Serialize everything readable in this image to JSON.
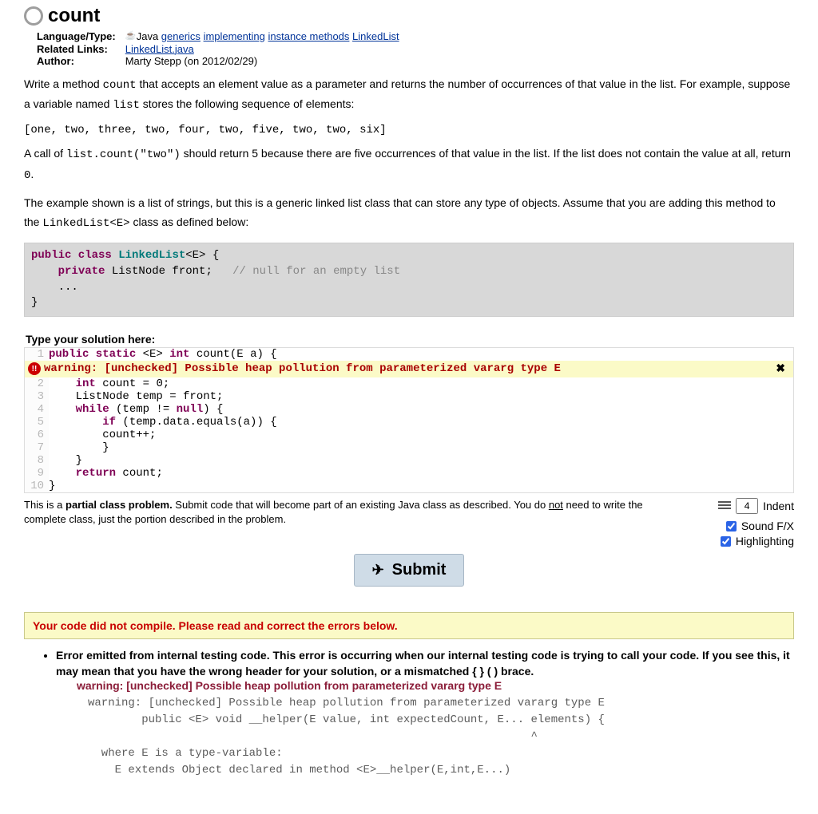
{
  "title": "count",
  "meta": {
    "rows": [
      {
        "label": "Language/Type:",
        "prefix": "Java",
        "links": [
          "generics",
          "implementing",
          "instance methods",
          "LinkedList"
        ]
      },
      {
        "label": "Related Links:",
        "prefix": "",
        "links": [
          "LinkedList.java"
        ]
      },
      {
        "label": "Author:",
        "prefix": "Marty Stepp (on 2012/02/29)",
        "links": []
      }
    ]
  },
  "desc": {
    "p1a": "Write a method ",
    "p1code1": "count",
    "p1b": " that accepts an element value as a parameter and returns the number of occurrences of that value in the list. For example, suppose a variable named ",
    "p1code2": "list",
    "p1c": " stores the following sequence of elements:",
    "seq": "[one, two, three, two, four, two, five, two, two, six]",
    "p2a": "A call of ",
    "p2code1": "list.count(\"two\")",
    "p2b": " should return 5 because there are five occurrences of that value in the list. If the list does not contain the value at all, return ",
    "p2code2": "0",
    "p2c": ".",
    "p3a": "The example shown is a list of strings, but this is a generic linked list class that can store any type of objects. Assume that you are adding this method to the ",
    "p3code1": "LinkedList<E>",
    "p3b": " class as defined below:"
  },
  "classbox": {
    "kw1": "public class",
    "type": "LinkedList",
    "gen": "<E>",
    "brace": " {",
    "line2_kw": "private",
    "line2_rest": " ListNode front;   ",
    "line2_cmt": "// null for an empty list",
    "line3": "    ...",
    "line4": "}"
  },
  "solution_label": "Type your solution here:",
  "editor": {
    "lines": [
      {
        "n": "1",
        "segments": [
          [
            "kw",
            "public static"
          ],
          [
            "",
            ""
          ],
          [
            "",
            " "
          ],
          [
            "",
            "<E>"
          ],
          [
            "",
            " "
          ],
          [
            "kw",
            "int"
          ],
          [
            "",
            " count(E a) {"
          ]
        ]
      },
      {
        "warn": true
      },
      {
        "n": "2",
        "segments": [
          [
            "",
            "    "
          ],
          [
            "kw",
            "int"
          ],
          [
            "",
            " count = 0;"
          ]
        ]
      },
      {
        "n": "3",
        "segments": [
          [
            "",
            "    ListNode temp = front;"
          ]
        ]
      },
      {
        "n": "4",
        "segments": [
          [
            "",
            "    "
          ],
          [
            "kw",
            "while"
          ],
          [
            "",
            " (temp != "
          ],
          [
            "kw",
            "null"
          ],
          [
            "",
            ") {"
          ]
        ]
      },
      {
        "n": "5",
        "segments": [
          [
            "",
            "        "
          ],
          [
            "kw",
            "if"
          ],
          [
            "",
            " (temp.data.equals(a)) {"
          ]
        ]
      },
      {
        "n": "6",
        "segments": [
          [
            "",
            "        count++;"
          ]
        ]
      },
      {
        "n": "7",
        "segments": [
          [
            "",
            "        }"
          ]
        ]
      },
      {
        "n": "8",
        "segments": [
          [
            "",
            "    }"
          ]
        ]
      },
      {
        "n": "9",
        "segments": [
          [
            "",
            "    "
          ],
          [
            "kw",
            "return"
          ],
          [
            "",
            " count;"
          ]
        ]
      },
      {
        "n": "10",
        "segments": [
          [
            "",
            "}"
          ]
        ]
      }
    ],
    "warning_text": "warning: [unchecked] Possible heap pollution from parameterized vararg type E"
  },
  "partial_note": {
    "a": "This is a ",
    "b": "partial class problem.",
    "c": " Submit code that will become part of an existing Java class as described. You do ",
    "not": "not",
    "d": " need to write the complete class, just the portion described in the problem."
  },
  "controls": {
    "indent_value": "4",
    "indent_label": "Indent",
    "sound_label": "Sound F/X",
    "highlight_label": "Highlighting"
  },
  "submit_label": "Submit",
  "compile_error": "Your code did not compile. Please read and correct the errors below.",
  "error_item": {
    "header": "Error emitted from internal testing code. This error is occurring when our internal testing code is trying to call your code. If you see this, it may mean that you have the wrong header for your solution, or a mismatched { } ( ) brace.",
    "warn": "warning: [unchecked] Possible heap pollution from parameterized vararg type E",
    "trace": "warning: [unchecked] Possible heap pollution from parameterized vararg type E\n        public <E> void __helper(E value, int expectedCount, E... elements) {\n                                                                  ^\n  where E is a type-variable:\n    E extends Object declared in method <E>__helper(E,int,E...)"
  }
}
